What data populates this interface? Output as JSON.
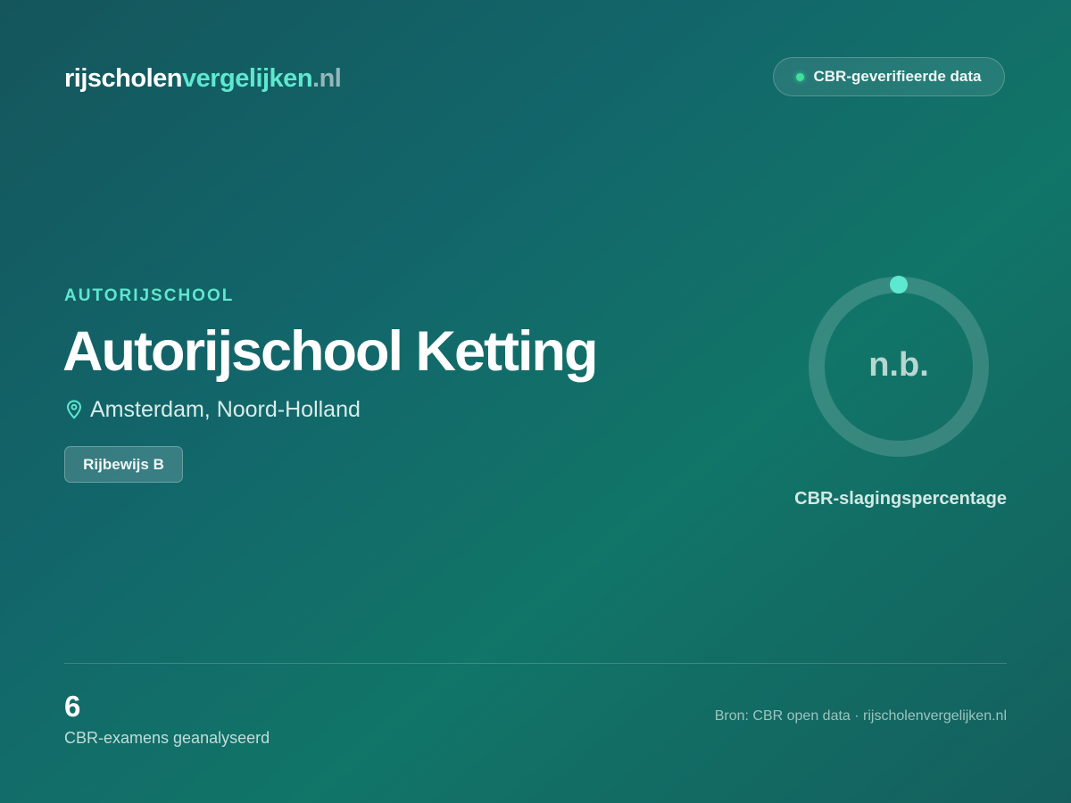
{
  "header": {
    "logo": {
      "part1": "rijscholen",
      "part2": "vergelijken",
      "part3": ".nl"
    },
    "badge": {
      "label": "CBR-geverifieerde data",
      "dot_color": "#3fe09b"
    }
  },
  "school": {
    "eyebrow": "AUTORIJSCHOOL",
    "name": "Autorijschool Ketting",
    "location": "Amsterdam, Noord-Holland",
    "location_icon": "map-pin-icon",
    "license_chip": "Rijbewijs B"
  },
  "pass_rate": {
    "value": "n.b.",
    "label": "CBR-slagingspercentage",
    "progress": 0,
    "accent_color": "#5ee8cf"
  },
  "footer": {
    "exam_count": "6",
    "exam_count_label": "CBR-examens geanalyseerd",
    "source": "Bron: CBR open data · rijscholenvergelijken.nl"
  },
  "colors": {
    "accent": "#5ee8cf",
    "background_start": "#14565c",
    "background_end": "#117568"
  }
}
